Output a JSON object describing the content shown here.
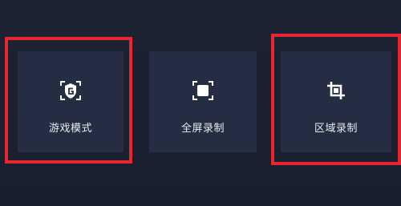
{
  "cards": {
    "game_mode": {
      "label": "游戏模式",
      "icon": "game-controller-icon"
    },
    "fullscreen": {
      "label": "全屏录制",
      "icon": "fullscreen-capture-icon"
    },
    "region": {
      "label": "区域录制",
      "icon": "crop-region-icon"
    }
  },
  "highlight_color": "#e8262f",
  "card_bg_color": "#252d42",
  "page_bg_color": "#1b2030"
}
